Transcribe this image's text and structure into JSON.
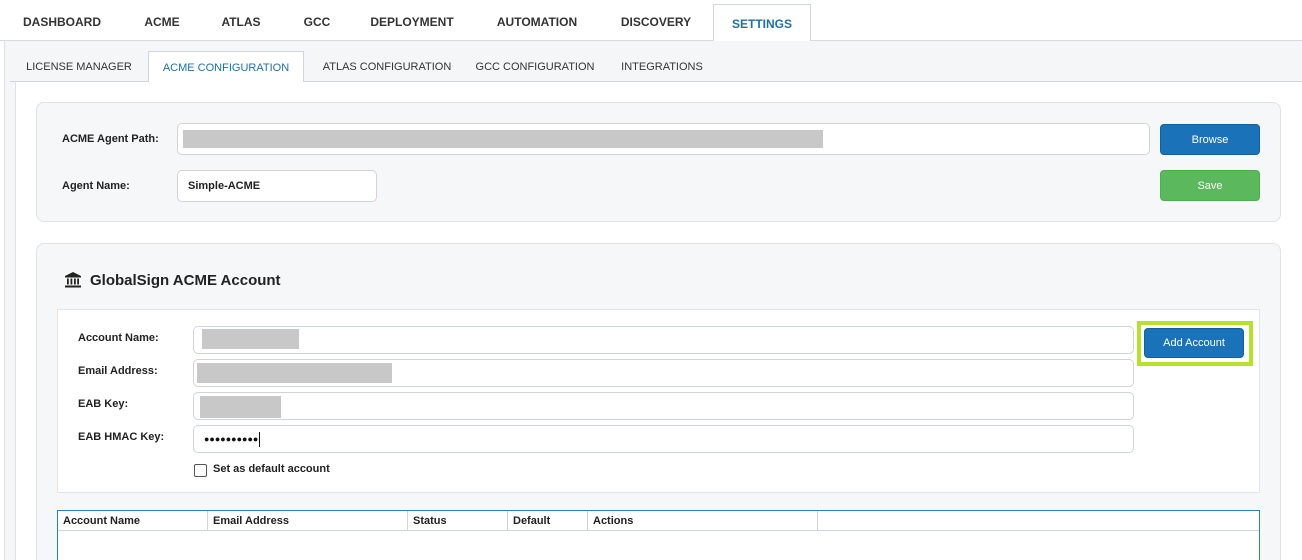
{
  "top_nav": {
    "tabs": [
      {
        "label": "DASHBOARD"
      },
      {
        "label": "ACME"
      },
      {
        "label": "ATLAS"
      },
      {
        "label": "GCC"
      },
      {
        "label": "DEPLOYMENT"
      },
      {
        "label": "AUTOMATION"
      },
      {
        "label": "DISCOVERY"
      },
      {
        "label": "SETTINGS",
        "active": true
      }
    ]
  },
  "sub_nav": {
    "tabs": [
      {
        "label": "LICENSE MANAGER"
      },
      {
        "label": "ACME CONFIGURATION",
        "active": true
      },
      {
        "label": "ATLAS CONFIGURATION"
      },
      {
        "label": "GCC CONFIGURATION"
      },
      {
        "label": "INTEGRATIONS"
      }
    ]
  },
  "agent_config": {
    "path_label": "ACME Agent Path:",
    "path_value": "",
    "name_label": "Agent Name:",
    "name_value": "Simple-ACME",
    "browse_label": "Browse",
    "save_label": "Save"
  },
  "account_section": {
    "title": "GlobalSign ACME Account",
    "icon": "bank-icon",
    "fields": {
      "account_name_label": "Account Name:",
      "email_label": "Email Address:",
      "eab_key_label": "EAB Key:",
      "eab_hmac_label": "EAB HMAC Key:",
      "eab_hmac_value": "●●●●●●●●●●"
    },
    "default_checkbox_label": "Set as default account",
    "add_account_label": "Add Account"
  },
  "accounts_table": {
    "columns": [
      "Account Name",
      "Email Address",
      "Status",
      "Default",
      "Actions"
    ]
  },
  "colors": {
    "primary_blue": "#1a73b8",
    "save_green": "#5cb85c",
    "highlight": "#b7e02f"
  }
}
